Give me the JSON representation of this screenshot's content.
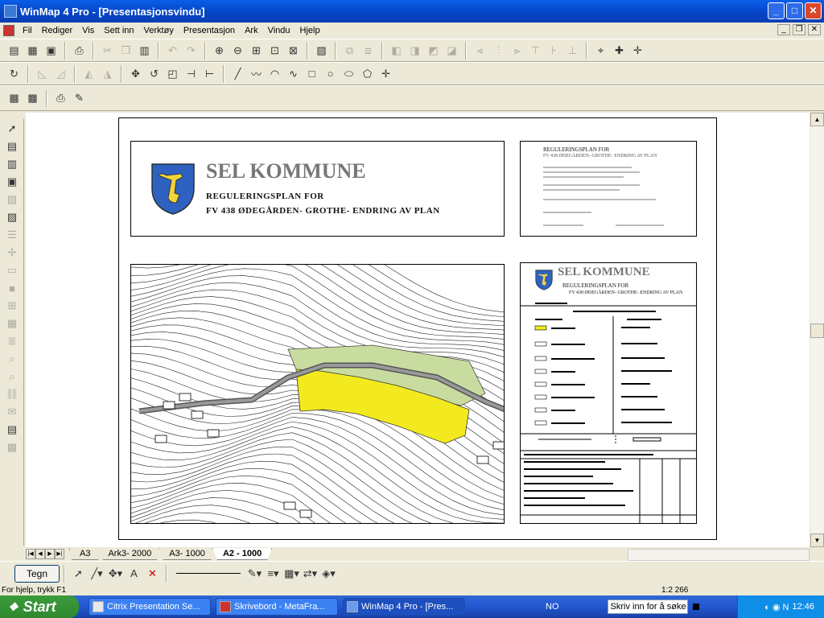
{
  "window": {
    "title": "WinMap 4 Pro - [Presentasjonsvindu]"
  },
  "menu": [
    "Fil",
    "Rediger",
    "Vis",
    "Sett inn",
    "Verktøy",
    "Presentasjon",
    "Ark",
    "Vindu",
    "Hjelp"
  ],
  "sheet": {
    "municipality": "SEL KOMMUNE",
    "plan_line1": "REGULERINGSPLAN FOR",
    "plan_line2": "FV 438 ØDEGÅRDEN- GROTHE- ENDRING AV PLAN",
    "info_title": "REGULERINGSPLAN FOR",
    "info_subtitle": "FV 438 ØDEGÅRDEN- GROTHE- ENDRING AV PLAN",
    "legend_municipality": "SEL KOMMUNE",
    "legend_line1": "REGULERINGSPLAN FOR",
    "legend_line2": "FV 438 ØDEGÅRDEN- GROTHE- ENDRING AV PLAN"
  },
  "tabs": [
    "A3",
    "Ark3- 2000",
    "A3- 1000",
    "A2 - 1000"
  ],
  "bottom": {
    "tegn_label": "Tegn"
  },
  "status": {
    "help": "For hjelp, trykk F1",
    "scale": "1:2 266"
  },
  "taskbar": {
    "start": "Start",
    "tasks": [
      "Citrix Presentation Se...",
      "Skrivebord - MetaFra...",
      "WinMap 4 Pro - [Pres..."
    ],
    "lang": "NO",
    "search_placeholder": "Skriv inn for å søke",
    "clock": "12:46"
  }
}
